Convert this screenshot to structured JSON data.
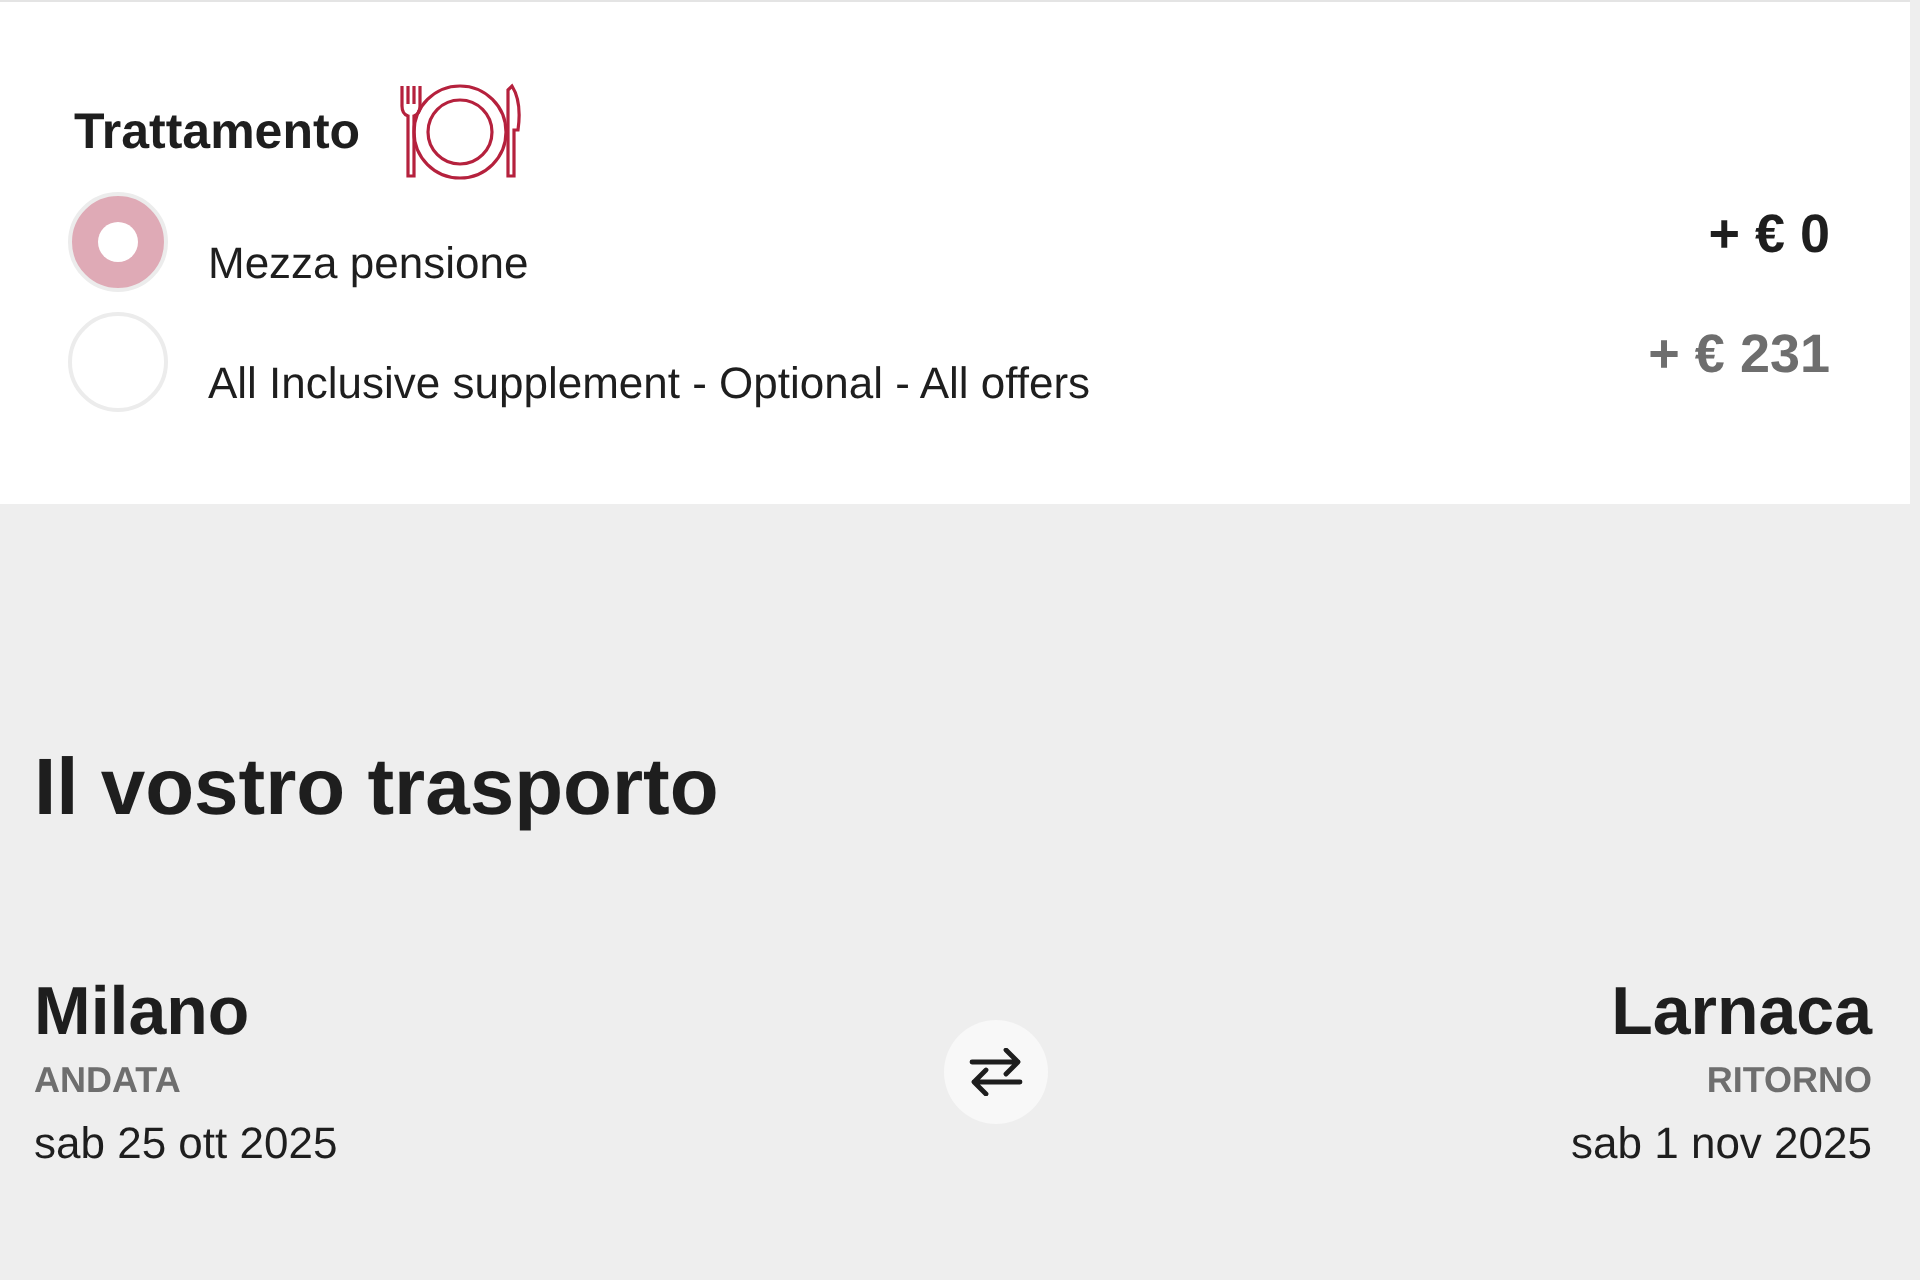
{
  "board": {
    "title": "Trattamento",
    "options": [
      {
        "label": "Mezza pensione",
        "price": "+ € 0",
        "selected": true
      },
      {
        "label": "All Inclusive supplement - Optional - All offers",
        "price": "+ € 231",
        "selected": false
      }
    ]
  },
  "transport": {
    "title": "Il vostro trasporto",
    "outbound": {
      "city": "Milano",
      "label": "ANDATA",
      "date": "sab 25 ott 2025"
    },
    "return": {
      "city": "Larnaca",
      "label": "RITORNO",
      "date": "sab 1 nov 2025"
    }
  }
}
